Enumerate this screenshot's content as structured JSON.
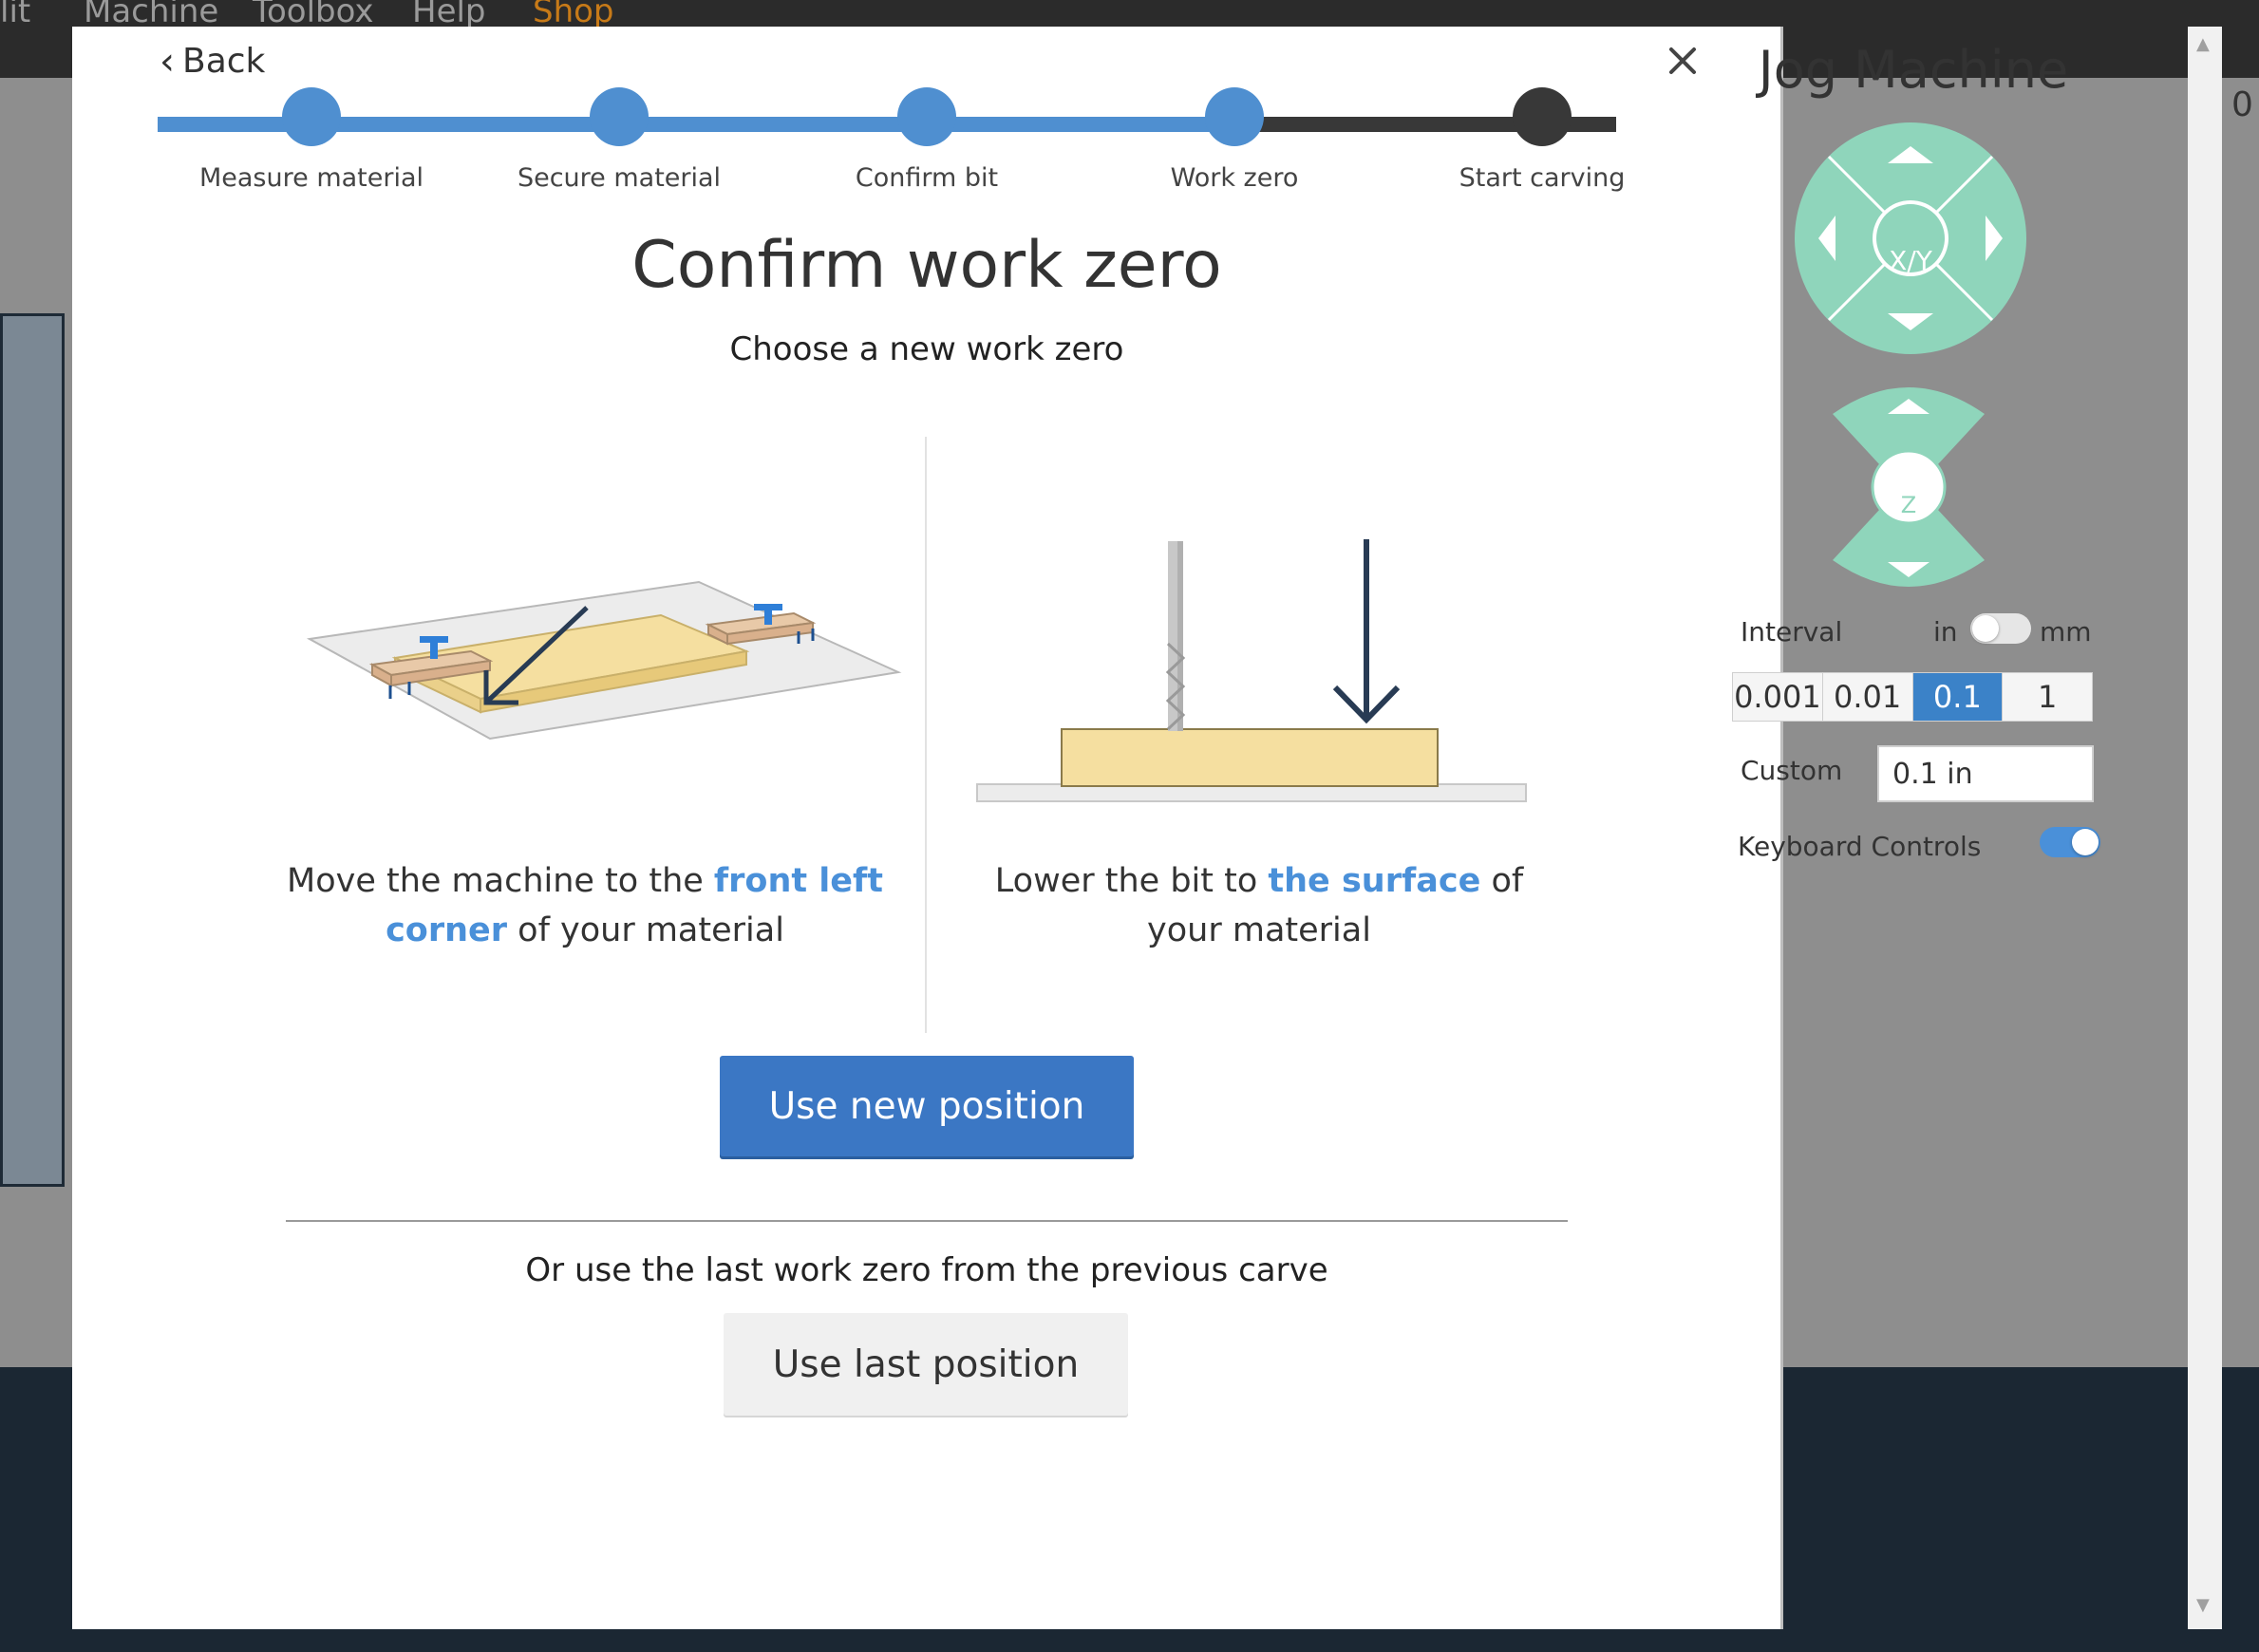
{
  "background_app": {
    "menu": [
      "lit",
      "Machine",
      "Toolbox",
      "Help",
      "Shop"
    ],
    "right_text": "0"
  },
  "wizard": {
    "back_label": "Back",
    "close_icon": "close-icon",
    "steps": [
      {
        "label": "Measure material",
        "state": "done"
      },
      {
        "label": "Secure material",
        "state": "done"
      },
      {
        "label": "Confirm bit",
        "state": "done"
      },
      {
        "label": "Work zero",
        "state": "current"
      },
      {
        "label": "Start carving",
        "state": "todo"
      }
    ],
    "title": "Confirm work zero",
    "subtitle": "Choose a new work zero",
    "left_instruction": {
      "before": "Move the machine to the ",
      "highlight": "front left corner",
      "after": " of your material"
    },
    "right_instruction": {
      "before": "Lower the bit to ",
      "highlight": "the surface",
      "after": " of your material"
    },
    "primary_button": "Use new position",
    "alt_text": "Or use the last work zero from the previous carve",
    "secondary_button": "Use last position"
  },
  "jog": {
    "title": "Jog Machine",
    "xy_label": "X/Y",
    "z_label": "Z",
    "interval_label": "Interval",
    "unit_left": "in",
    "unit_right": "mm",
    "unit_selected": "in",
    "intervals": [
      "0.001",
      "0.01",
      "0.1",
      "1"
    ],
    "interval_selected": "0.1",
    "custom_label": "Custom",
    "custom_value": "0.1 in",
    "keyboard_label": "Keyboard Controls",
    "keyboard_enabled": true
  },
  "colors": {
    "accent_blue": "#4f8fd0",
    "button_blue": "#3b77c4",
    "jog_green": "#8fd5bb",
    "material_yellow": "#f5dfa0"
  }
}
